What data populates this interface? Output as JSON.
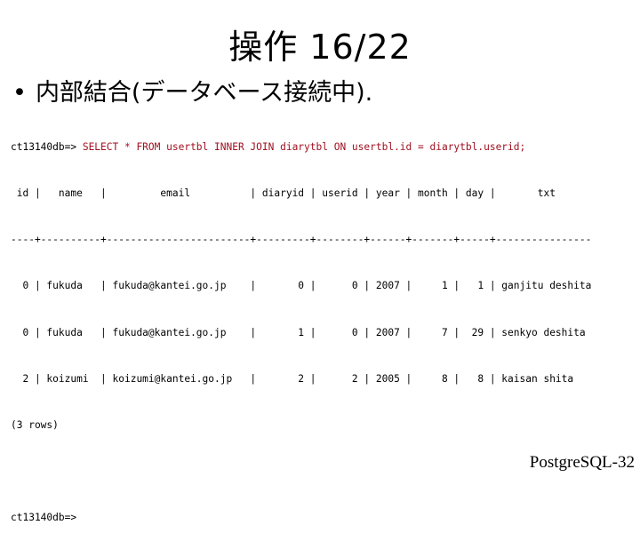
{
  "slide": {
    "title": "操作 16/22",
    "bullet_symbol": "•",
    "bullet_text": "内部結合(データベース接続中).",
    "footer": "PostgreSQL-32"
  },
  "terminal": {
    "prompt": "ct13140db=> ",
    "command": "SELECT * FROM usertbl INNER JOIN diarytbl ON usertbl.id = diarytbl.userid;",
    "header": " id |   name   |         email          | diaryid | userid | year | month | day |       txt",
    "separator": "----+----------+------------------------+---------+--------+------+-------+-----+----------------",
    "rows": [
      "  0 | fukuda   | fukuda@kantei.go.jp    |       0 |      0 | 2007 |     1 |   1 | ganjitu deshita",
      "  0 | fukuda   | fukuda@kantei.go.jp    |       1 |      0 | 2007 |     7 |  29 | senkyo deshita",
      "  2 | koizumi  | koizumi@kantei.go.jp   |       2 |      2 | 2005 |     8 |   8 | kaisan shita"
    ],
    "row_count": "(3 rows)",
    "final_prompt": "ct13140db=>",
    "table": {
      "columns": [
        "id",
        "name",
        "email",
        "diaryid",
        "userid",
        "year",
        "month",
        "day",
        "txt"
      ],
      "data": [
        [
          "0",
          "fukuda",
          "fukuda@kantei.go.jp",
          "0",
          "0",
          "2007",
          "1",
          "1",
          "ganjitu deshita"
        ],
        [
          "0",
          "fukuda",
          "fukuda@kantei.go.jp",
          "1",
          "0",
          "2007",
          "7",
          "29",
          "senkyo deshita"
        ],
        [
          "2",
          "koizumi",
          "koizumi@kantei.go.jp",
          "2",
          "2",
          "2005",
          "8",
          "8",
          "kaisan shita"
        ]
      ]
    }
  }
}
